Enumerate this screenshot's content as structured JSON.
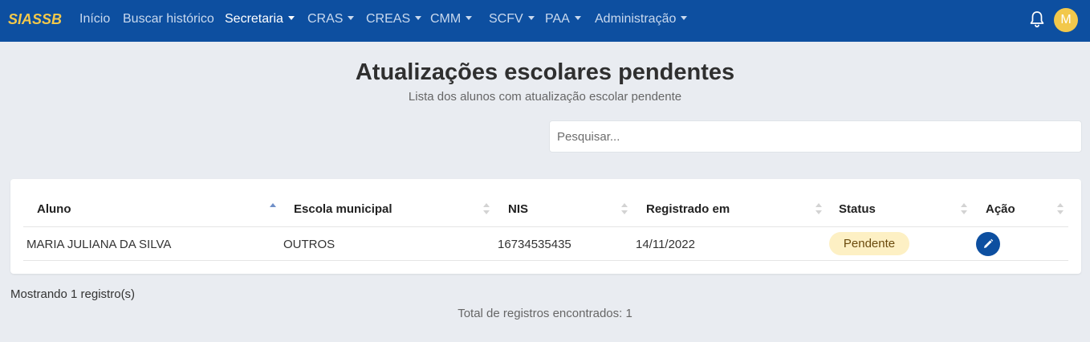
{
  "nav": {
    "brand": "SIASSB",
    "items": [
      {
        "label": "Início"
      },
      {
        "label": "Buscar histórico"
      },
      {
        "label": "Secretaria"
      },
      {
        "label": "CRAS"
      },
      {
        "label": "CREAS"
      },
      {
        "label": "CMM"
      },
      {
        "label": "SCFV"
      },
      {
        "label": "PAA"
      },
      {
        "label": "Administração"
      }
    ],
    "avatar_initial": "M"
  },
  "page": {
    "title": "Atualizações escolares pendentes",
    "subtitle": "Lista dos alunos com atualização escolar pendente"
  },
  "search": {
    "placeholder": "Pesquisar..."
  },
  "table": {
    "headers": [
      "Aluno",
      "Escola municipal",
      "NIS",
      "Registrado em",
      "Status",
      "Ação"
    ],
    "rows": [
      {
        "aluno": "MARIA JULIANA DA SILVA",
        "escola": "OUTROS",
        "nis": "16734535435",
        "registrado": "14/11/2022",
        "status": "Pendente"
      }
    ]
  },
  "footer": {
    "showing": "Mostrando 1 registro(s)",
    "total": "Total de registros encontrados: 1"
  },
  "colors": {
    "navbar": "#0d4fa0",
    "brand": "#f2c84b",
    "badge_bg": "#fdf0c4",
    "action_button": "#0d4fa0"
  }
}
